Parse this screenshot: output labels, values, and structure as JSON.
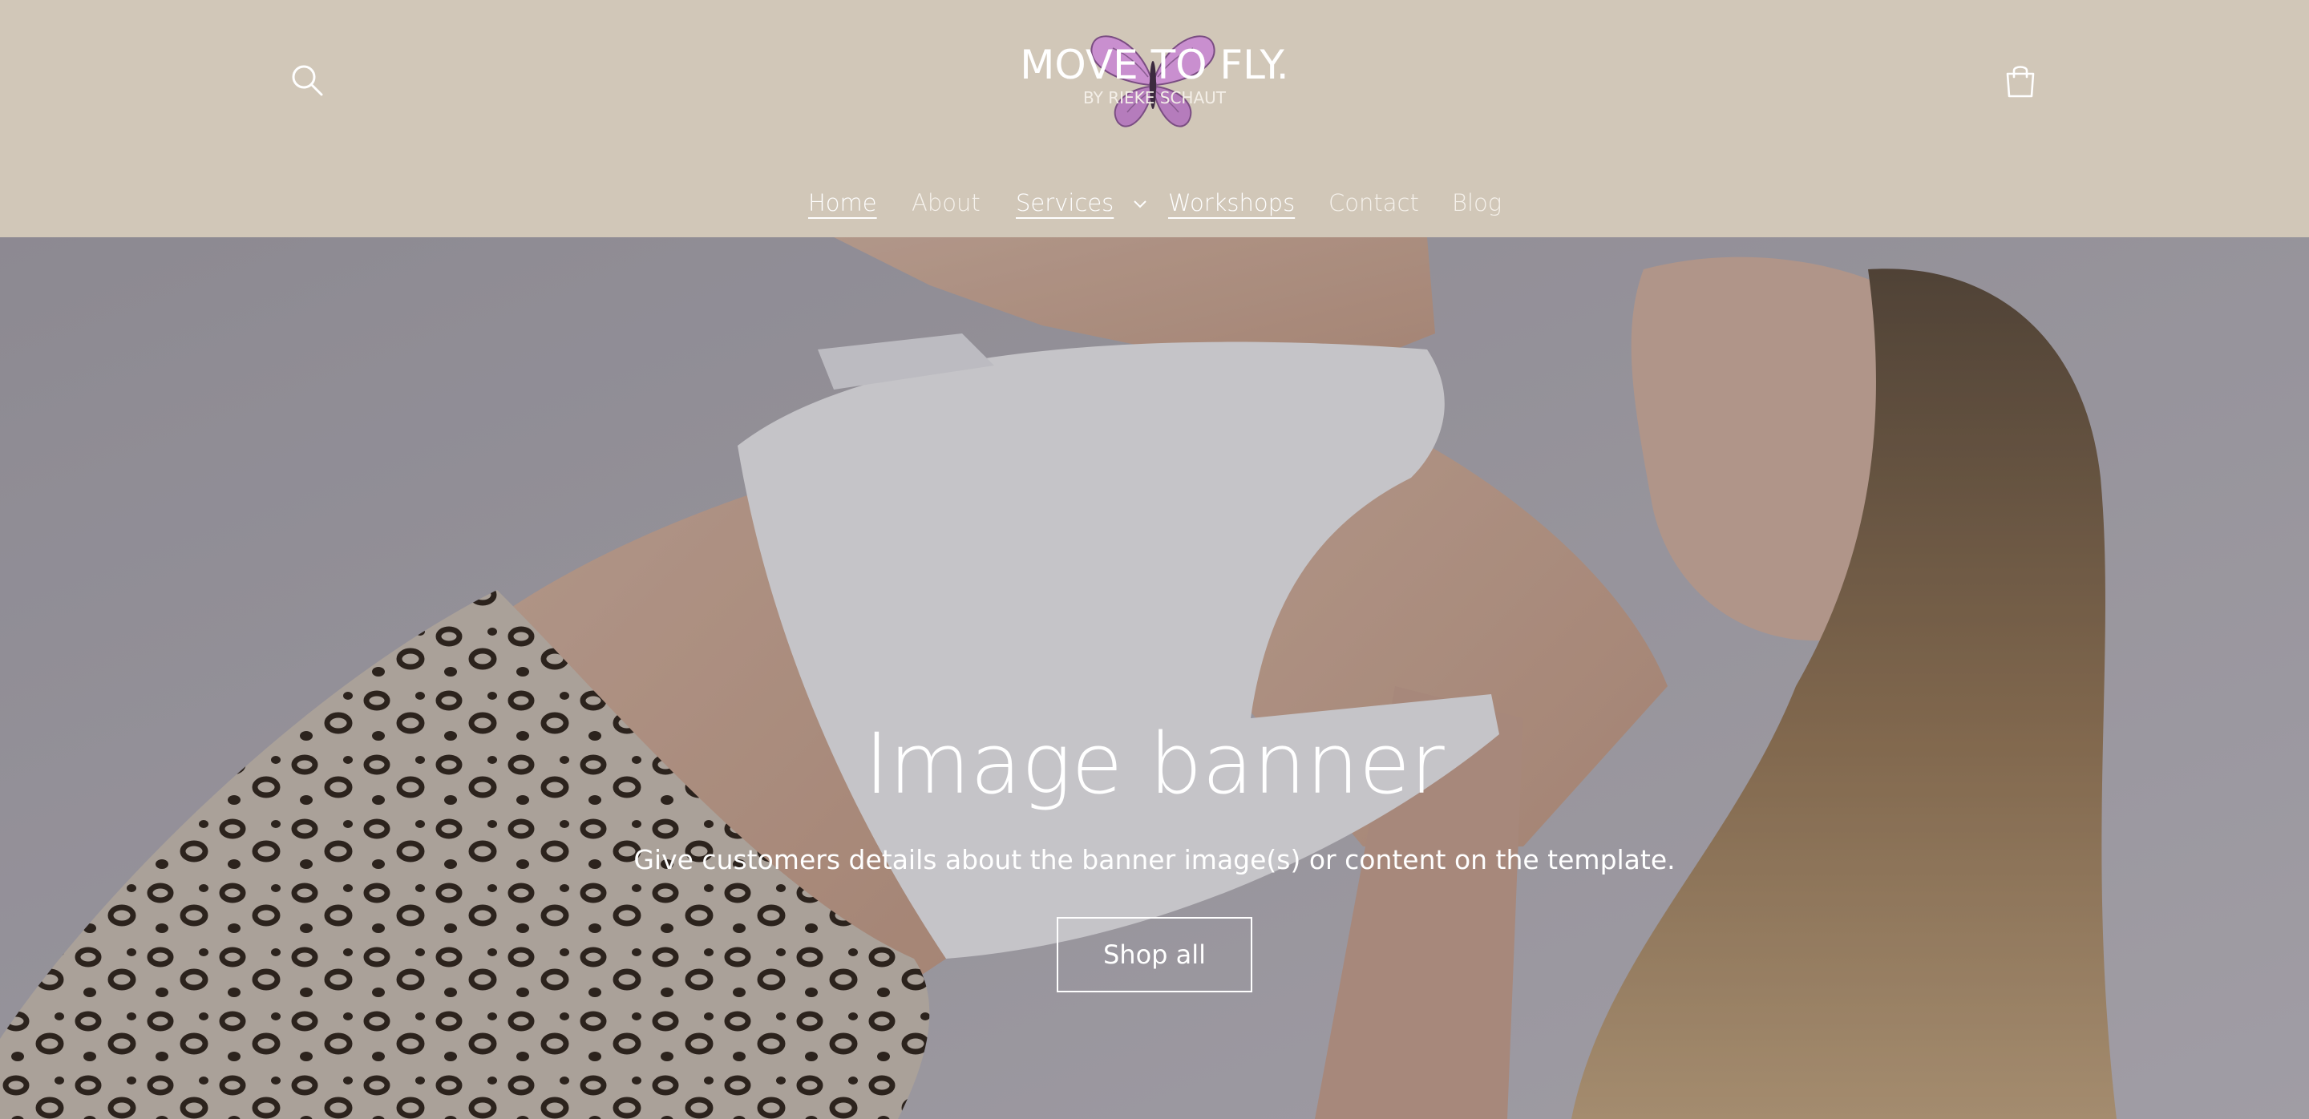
{
  "header": {
    "logo": {
      "title": "MOVE TO FLY.",
      "subtitle": "BY RIEKE SCHAUT",
      "butterfly_color": "#c98fcf"
    },
    "search_icon": "search-icon",
    "cart_icon": "cart-icon",
    "background": "#d1c7b8"
  },
  "nav": {
    "items": [
      {
        "label": "Home",
        "active": true
      },
      {
        "label": "About"
      },
      {
        "label": "Services",
        "has_dropdown": true
      },
      {
        "label": "Workshops"
      },
      {
        "label": "Contact"
      },
      {
        "label": "Blog"
      }
    ]
  },
  "hero": {
    "title": "Image banner",
    "subtitle": "Give customers details about the banner image(s) or content on the template.",
    "button_label": "Shop all"
  }
}
